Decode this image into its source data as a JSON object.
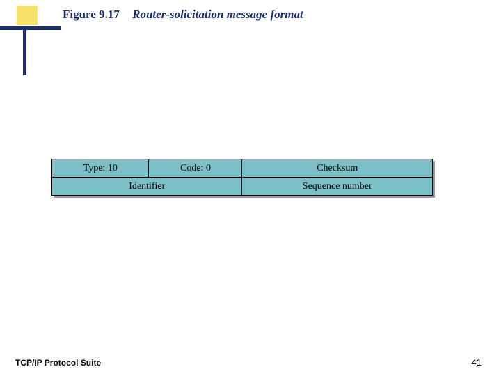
{
  "heading": {
    "label": "Figure 9.17",
    "title": "Router-solicitation message format"
  },
  "fields": {
    "row1": {
      "type": "Type: 10",
      "code": "Code: 0",
      "checksum": "Checksum"
    },
    "row2": {
      "identifier": "Identifier",
      "sequence": "Sequence number"
    }
  },
  "footer": {
    "suite": "TCP/IP Protocol Suite",
    "page": "41"
  }
}
